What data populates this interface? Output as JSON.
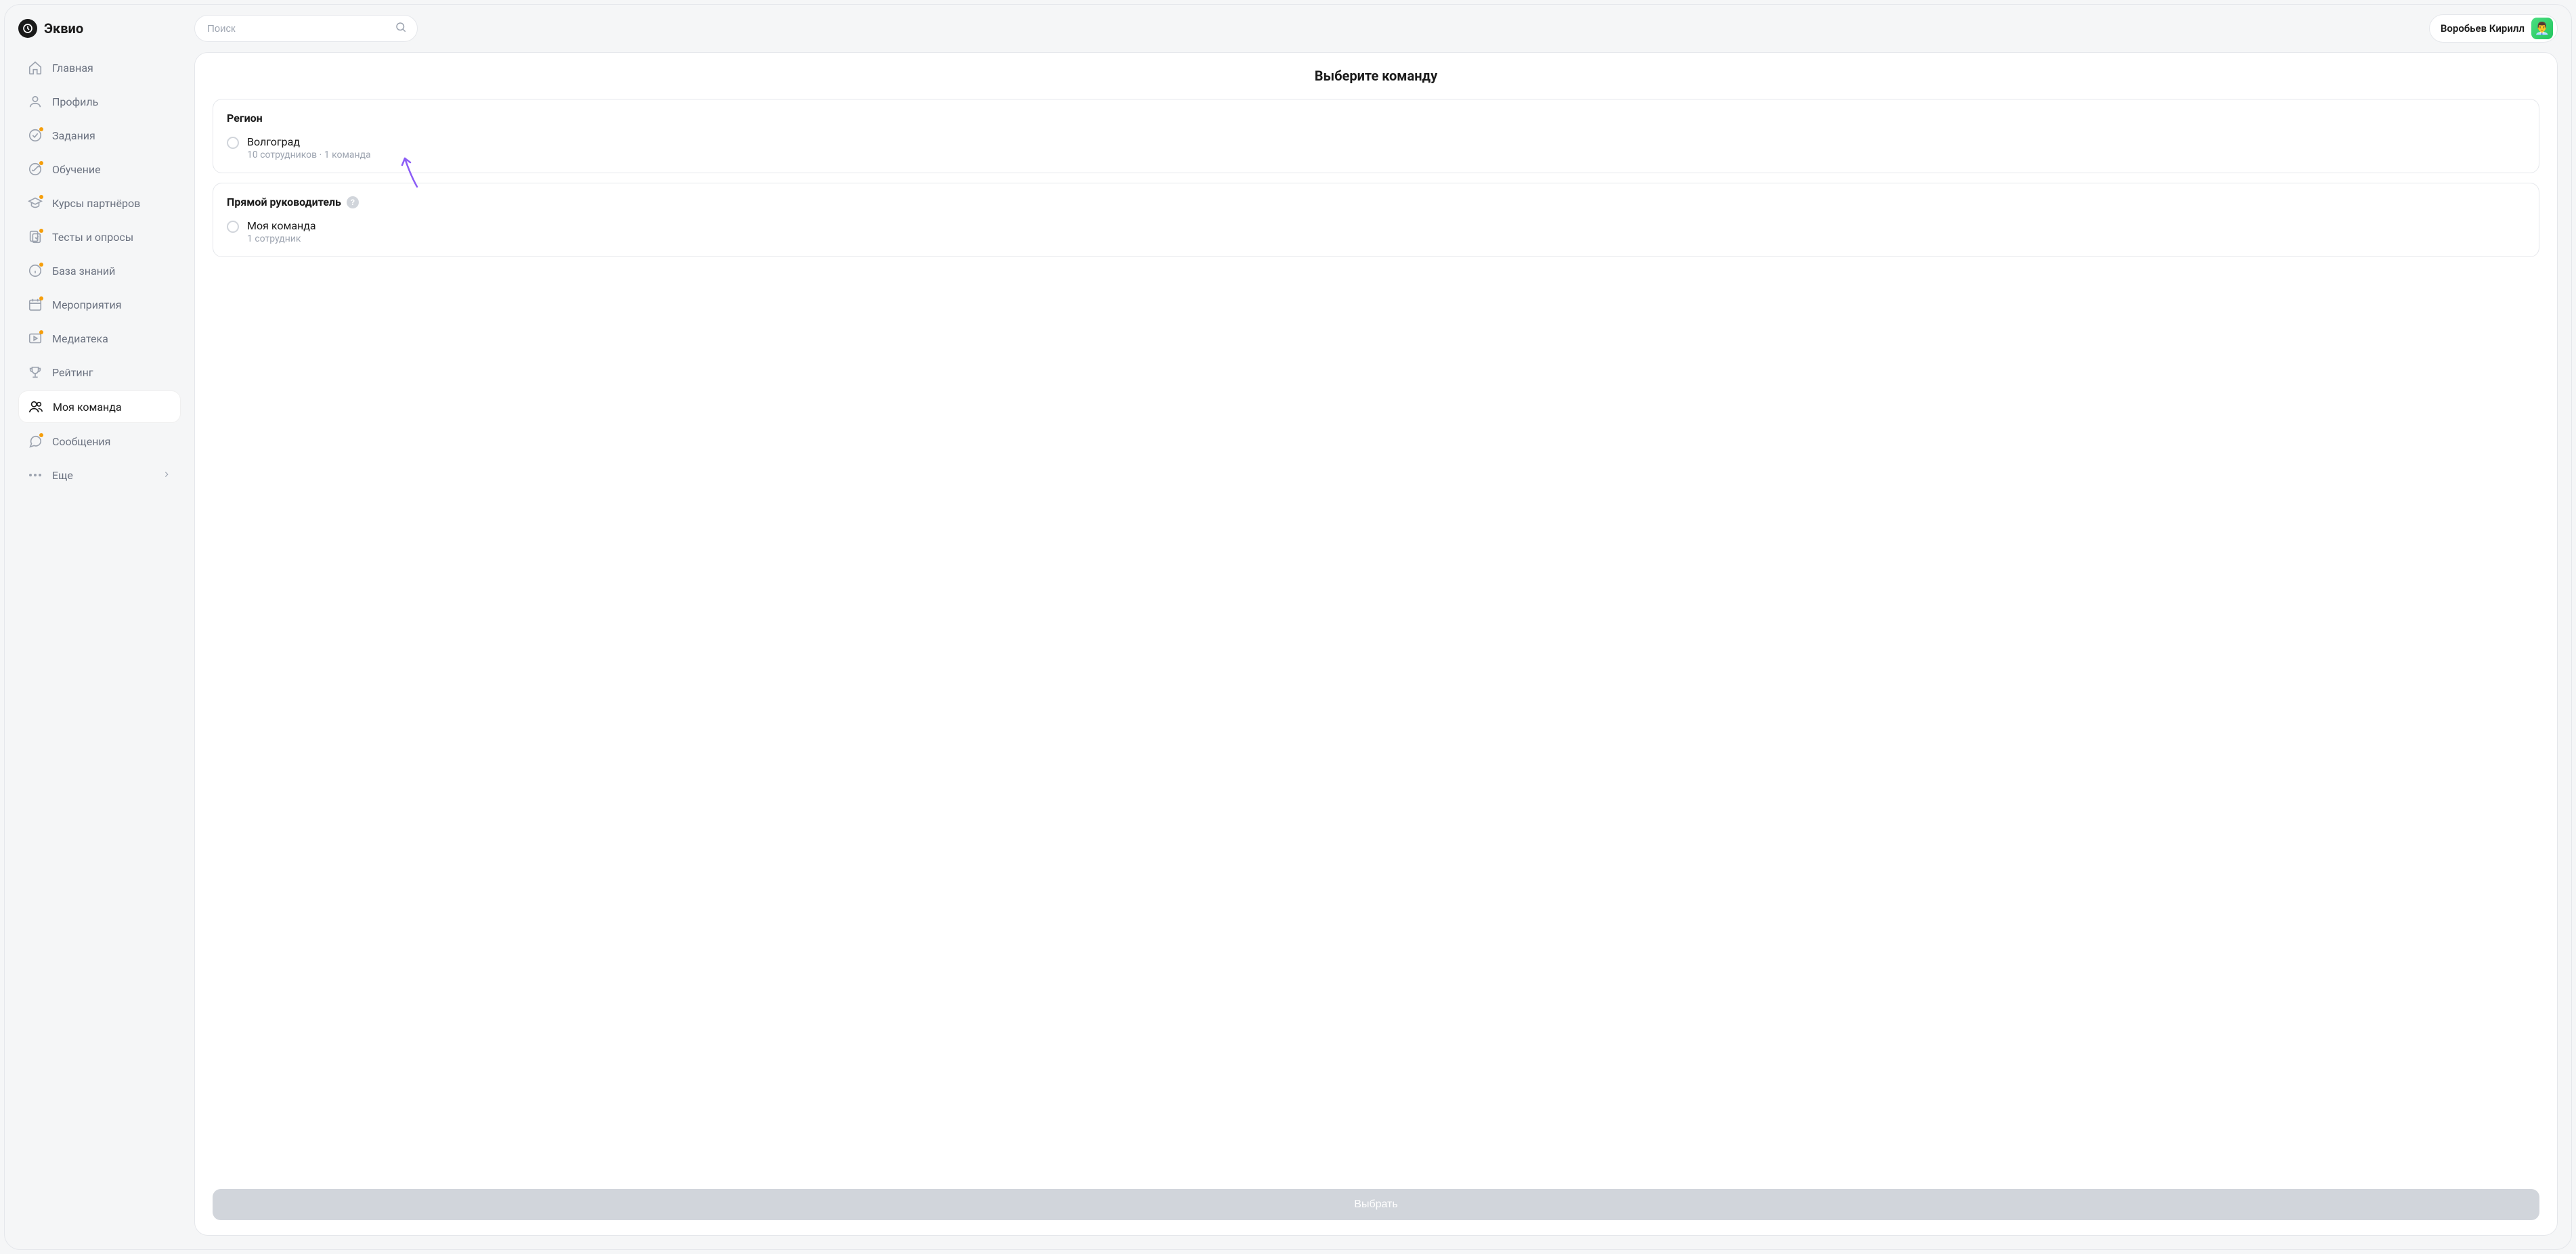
{
  "brand": "Эквио",
  "search": {
    "placeholder": "Поиск"
  },
  "user": {
    "name": "Воробьев Кирилл"
  },
  "sidebar": {
    "items": [
      {
        "label": "Главная",
        "dot": false,
        "active": false
      },
      {
        "label": "Профиль",
        "dot": false,
        "active": false
      },
      {
        "label": "Задания",
        "dot": true,
        "active": false
      },
      {
        "label": "Обучение",
        "dot": true,
        "active": false
      },
      {
        "label": "Курсы партнёров",
        "dot": true,
        "active": false
      },
      {
        "label": "Тесты и опросы",
        "dot": true,
        "active": false
      },
      {
        "label": "База знаний",
        "dot": true,
        "active": false
      },
      {
        "label": "Мероприятия",
        "dot": true,
        "active": false
      },
      {
        "label": "Медиатека",
        "dot": true,
        "active": false
      },
      {
        "label": "Рейтинг",
        "dot": false,
        "active": false
      },
      {
        "label": "Моя команда",
        "dot": false,
        "active": true
      },
      {
        "label": "Сообщения",
        "dot": true,
        "active": false
      },
      {
        "label": "Еще",
        "dot": false,
        "active": false
      }
    ]
  },
  "panel": {
    "title": "Выберите команду",
    "groups": [
      {
        "label": "Регион",
        "help": false,
        "options": [
          {
            "title": "Волгоград",
            "subtitle": "10 сотрудников · 1 команда"
          }
        ]
      },
      {
        "label": "Прямой руководитель",
        "help": true,
        "options": [
          {
            "title": "Моя команда",
            "subtitle": "1 сотрудник"
          }
        ]
      }
    ],
    "button_label": "Выбрать"
  }
}
